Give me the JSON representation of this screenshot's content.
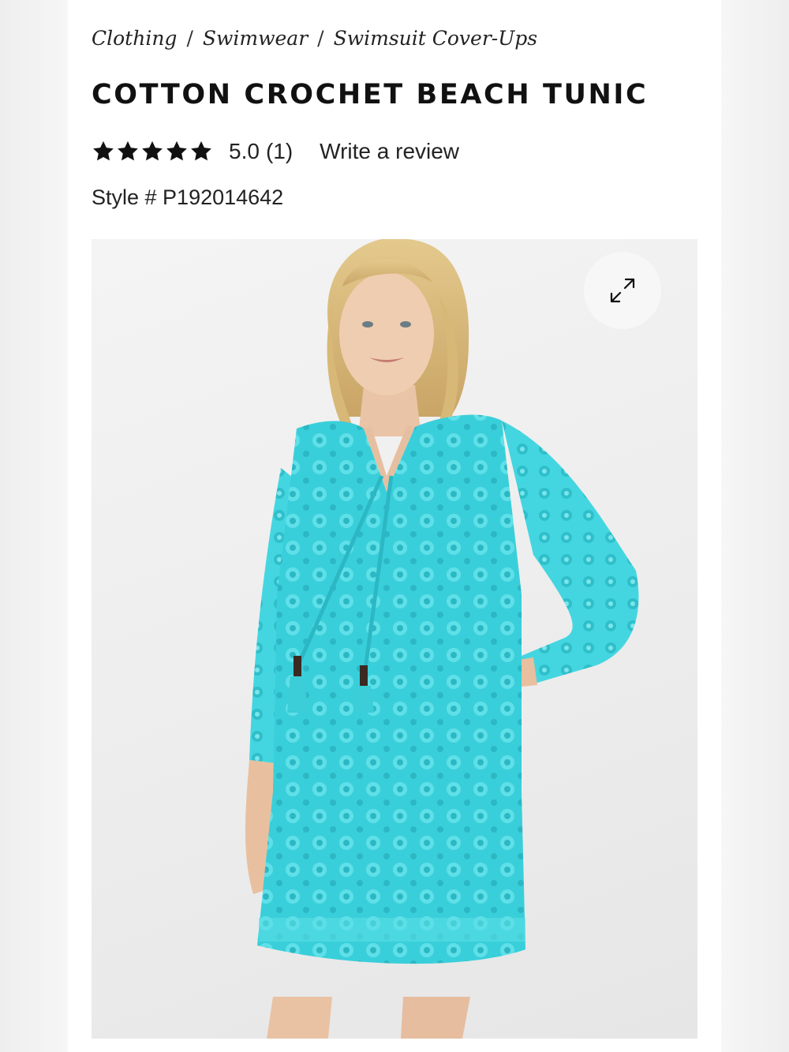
{
  "breadcrumb": {
    "items": [
      "Clothing",
      "Swimwear",
      "Swimsuit Cover-Ups"
    ],
    "separator": "/"
  },
  "product": {
    "title": "COTTON CROCHET BEACH TUNIC",
    "rating": {
      "stars": 5,
      "score": "5.0",
      "count": "(1)"
    },
    "write_review": "Write a review",
    "style_label": "Style # P192014642",
    "image_icon": "expand-icon",
    "colors": {
      "tunic": "#3fd3dd",
      "star": "#111111"
    }
  }
}
